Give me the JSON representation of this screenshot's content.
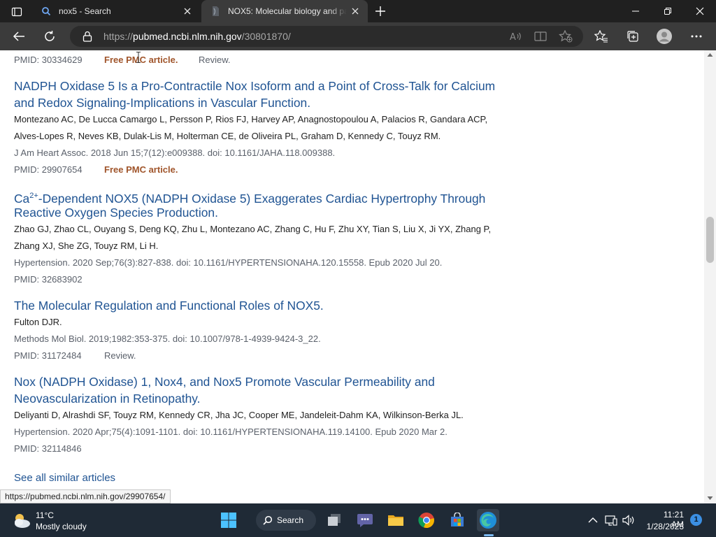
{
  "browser": {
    "tabs": [
      {
        "title": "nox5 - Search",
        "active": false
      },
      {
        "title": "NOX5: Molecular biology and pa",
        "active": true
      }
    ],
    "address": {
      "prefix": "https://",
      "host": "pubmed.ncbi.nlm.nih.gov",
      "path": "/30801870/"
    }
  },
  "page": {
    "top_meta": {
      "pmid": "PMID: 30334629",
      "pmc": "Free PMC article.",
      "review": "Review."
    },
    "articles": [
      {
        "title_line1": "NADPH Oxidase 5 Is a Pro-Contractile Nox Isoform and a Point of Cross-Talk for Calcium",
        "title_line2": "and Redox Signaling-Implications in Vascular Function.",
        "authors_line1": "Montezano AC, De Lucca Camargo L, Persson P, Rios FJ, Harvey AP, Anagnostopoulou A, Palacios R, Gandara ACP,",
        "authors_line2": "Alves-Lopes R, Neves KB, Dulak-Lis M, Holterman CE, de Oliveira PL, Graham D, Kennedy C, Touyz RM.",
        "citation": "J Am Heart Assoc. 2018 Jun 15;7(12):e009388. doi: 10.1161/JAHA.118.009388.",
        "pmid": "PMID: 29907654",
        "pmc": "Free PMC article."
      },
      {
        "title_pre": "Ca",
        "title_sup": "2+",
        "title_line1_rest": "-Dependent NOX5 (NADPH Oxidase 5) Exaggerates Cardiac Hypertrophy Through",
        "title_line2": "Reactive Oxygen Species Production.",
        "authors_line1": "Zhao GJ, Zhao CL, Ouyang S, Deng KQ, Zhu L, Montezano AC, Zhang C, Hu F, Zhu XY, Tian S, Liu X, Ji YX, Zhang P,",
        "authors_line2": "Zhang XJ, She ZG, Touyz RM, Li H.",
        "citation": "Hypertension. 2020 Sep;76(3):827-838. doi: 10.1161/HYPERTENSIONAHA.120.15558. Epub 2020 Jul 20.",
        "pmid": "PMID: 32683902"
      },
      {
        "title_line1": "The Molecular Regulation and Functional Roles of NOX5.",
        "authors_line1": "Fulton DJR.",
        "citation": "Methods Mol Biol. 2019;1982:353-375. doi: 10.1007/978-1-4939-9424-3_22.",
        "pmid": "PMID: 31172484",
        "review": "Review."
      },
      {
        "title_line1": "Nox (NADPH Oxidase) 1, Nox4, and Nox5 Promote Vascular Permeability and",
        "title_line2": "Neovascularization in Retinopathy.",
        "authors_line1": "Deliyanti D, Alrashdi SF, Touyz RM, Kennedy CR, Jha JC, Cooper ME, Jandeleit-Dahm KA, Wilkinson-Berka JL.",
        "citation": "Hypertension. 2020 Apr;75(4):1091-1101. doi: 10.1161/HYPERTENSIONAHA.119.14100. Epub 2020 Mar 2.",
        "pmid": "PMID: 32114846"
      }
    ],
    "see_all": "See all similar articles",
    "status_url": "https://pubmed.ncbi.nlm.nih.gov/29907654/"
  },
  "taskbar": {
    "weather": {
      "temp": "11°C",
      "desc": "Mostly cloudy"
    },
    "search_label": "Search",
    "clock": {
      "time": "11:21 AM",
      "date": "1/28/2023"
    },
    "notification_count": "1"
  },
  "colors": {
    "link": "#205493",
    "pmc": "#a0552b",
    "meta": "#5b616b"
  }
}
